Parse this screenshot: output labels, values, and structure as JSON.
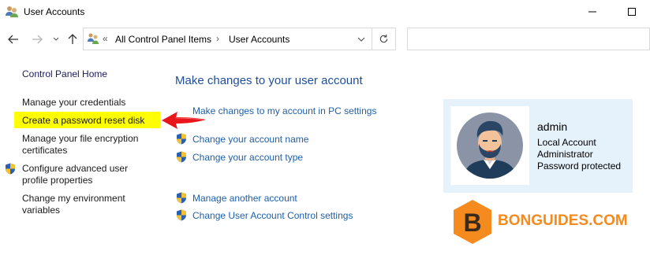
{
  "window": {
    "title": "User Accounts"
  },
  "navigation": {
    "breadcrumb_overflow": "«",
    "breadcrumb": [
      "All Control Panel Items",
      "User Accounts"
    ],
    "separator": "›",
    "search_placeholder": ""
  },
  "sidebar": {
    "home": "Control Panel Home",
    "items": [
      {
        "label": "Manage your credentials",
        "shield": false
      },
      {
        "label": "Create a password reset disk",
        "shield": false,
        "highlighted": true
      },
      {
        "label": "Manage your file encryption certificates",
        "shield": false
      },
      {
        "label": "Configure advanced user profile properties",
        "shield": true
      },
      {
        "label": "Change my environment variables",
        "shield": false
      }
    ]
  },
  "main": {
    "heading": "Make changes to your user account",
    "links": [
      {
        "label": "Make changes to my account in PC settings",
        "shield": false
      },
      {
        "label": "Change your account name",
        "shield": true
      },
      {
        "label": "Change your account type",
        "shield": true
      },
      {
        "label": "Manage another account",
        "shield": true
      },
      {
        "label": "Change User Account Control settings",
        "shield": true
      }
    ]
  },
  "account": {
    "name": "admin",
    "details": [
      "Local Account",
      "Administrator",
      "Password protected"
    ]
  },
  "watermark": {
    "letter": "B",
    "text": "BONGUIDES.COM"
  },
  "colors": {
    "link": "#1f5fa8",
    "heading": "#1e4e9a",
    "highlight": "#ffff00",
    "arrow": "#e8151b",
    "account_panel": "#e5f1fb",
    "watermark": "#f58a1f"
  }
}
